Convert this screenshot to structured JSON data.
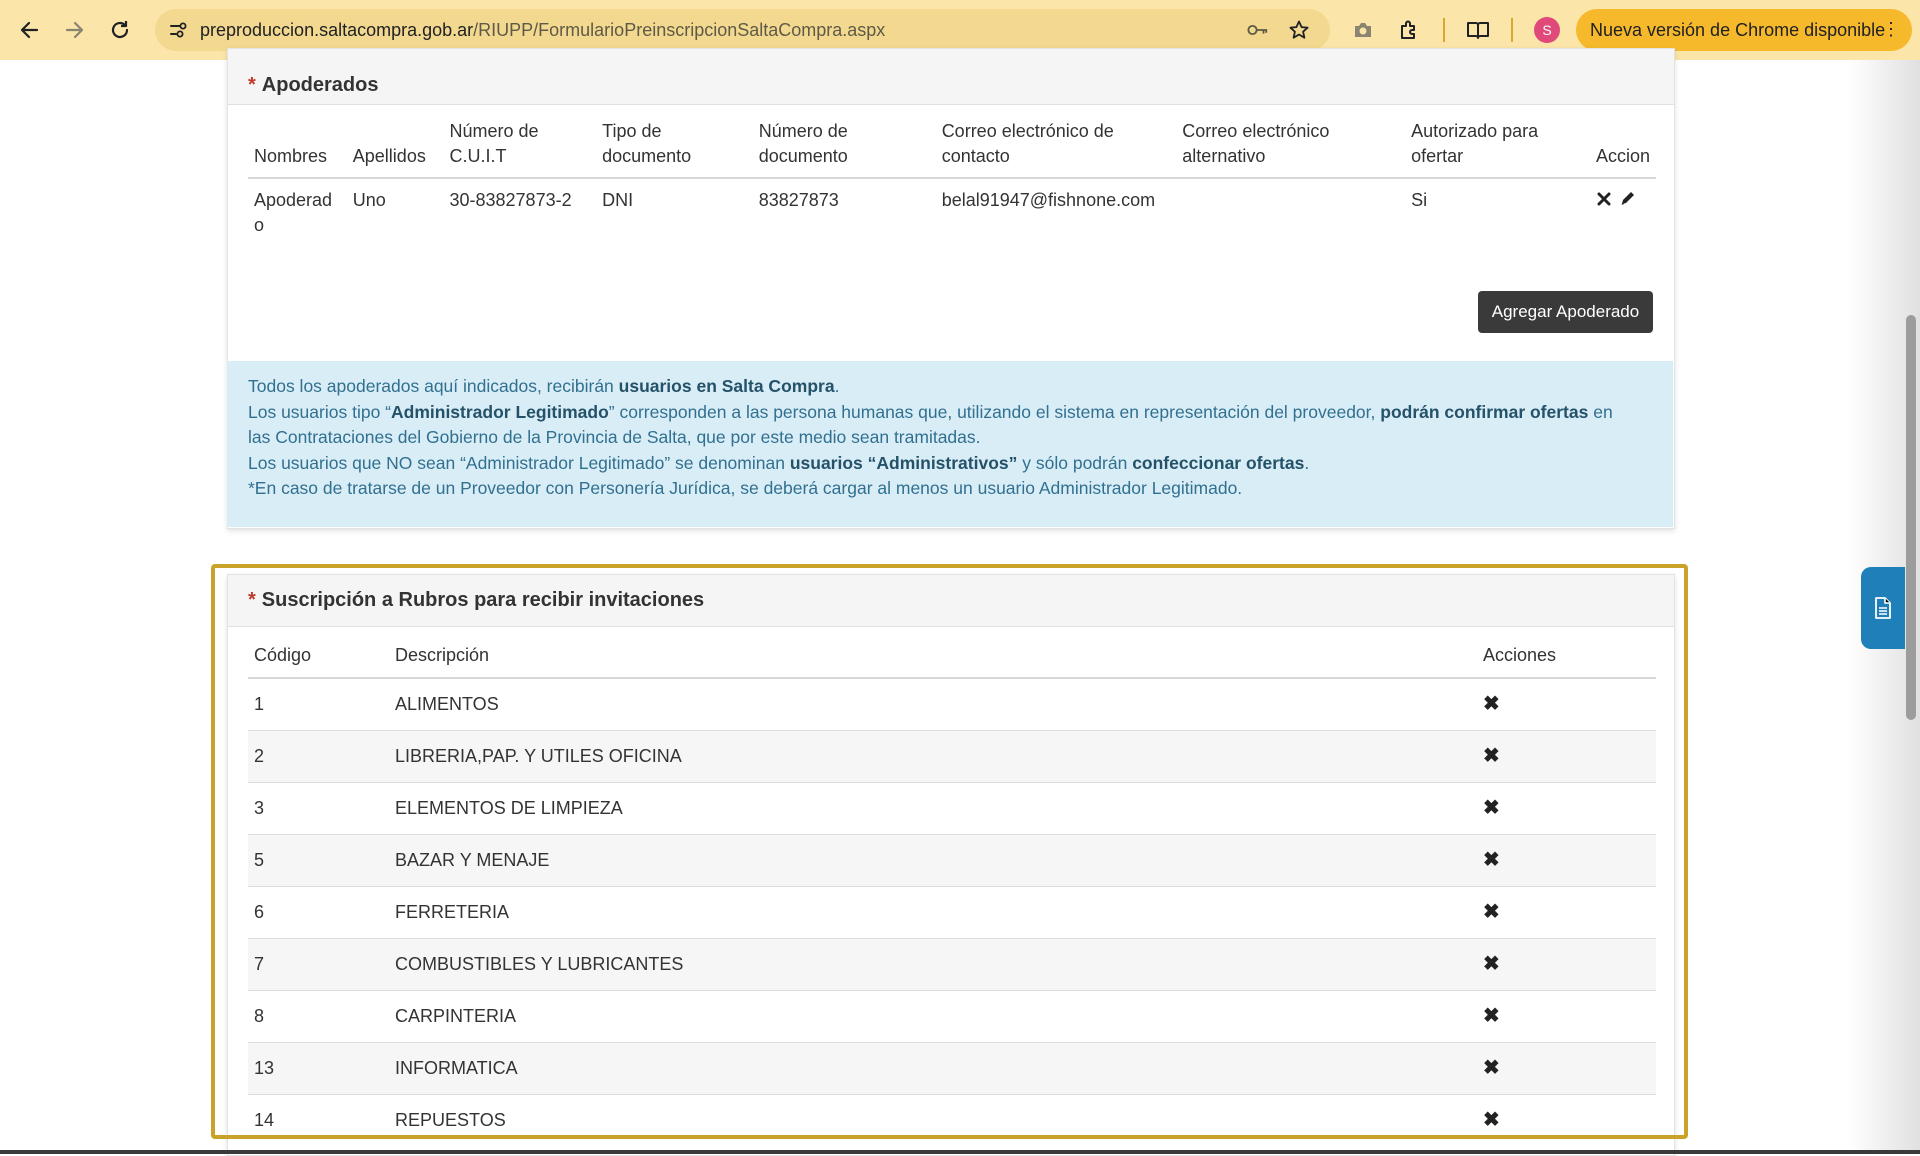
{
  "browser": {
    "url_host": "preproduccion.saltacompra.gob.ar",
    "url_path": "/RIUPP/FormularioPreinscripcionSaltaCompra.aspx",
    "avatar_letter": "S",
    "update_label": "Nueva versión de Chrome disponible",
    "menu_glyph": "⋮",
    "colors": {
      "toolbar": "#fbe5a8",
      "omnibox": "#f3d98f",
      "update_pill": "#f6b92b"
    },
    "icons": [
      "back-arrow-icon",
      "forward-arrow-icon",
      "reload-icon",
      "site-settings-icon",
      "password-key-icon",
      "bookmark-star-icon",
      "camera-icon",
      "extensions-icon",
      "reading-mode-icon"
    ]
  },
  "apoderados": {
    "required_mark": "*",
    "title": "Apoderados",
    "columns": {
      "nombres": "Nombres",
      "apellidos": "Apellidos",
      "cuit_1": "Número de",
      "cuit_2": "C.U.I.T",
      "tipo_doc_1": "Tipo de",
      "tipo_doc_2": "documento",
      "num_doc_1": "Número de",
      "num_doc_2": "documento",
      "correo_1": "Correo electrónico de",
      "correo_2": "contacto",
      "correo_alt_1": "Correo electrónico",
      "correo_alt_2": "alternativo",
      "autorizado_1": "Autorizado para",
      "autorizado_2": "ofertar",
      "accion": "Accion"
    },
    "rows": [
      {
        "nombres_1": "Apoderad",
        "nombres_2": "o",
        "apellidos": "Uno",
        "cuit": "30-83827873-2",
        "tipo_doc": "DNI",
        "num_doc": "83827873",
        "correo": "belal91947@fishnone.com",
        "correo_alt": "",
        "autorizado": "Si"
      }
    ],
    "add_button": "Agregar Apoderado"
  },
  "info": {
    "l1_a": "Todos los apoderados aquí indicados, recibirán ",
    "l1_b": "usuarios en Salta Compra",
    "l1_c": ".",
    "l2_a": "Los usuarios tipo “",
    "l2_b": "Administrador Legitimado",
    "l2_c": "” corresponden a las persona humanas que, utilizando el sistema en representación del proveedor, ",
    "l2_d": "podrán confirmar ofertas",
    "l2_e": " en",
    "l3": "las Contrataciones del Gobierno de la Provincia de Salta, que por este medio sean tramitadas.",
    "l4_a": "Los usuarios que NO sean “Administrador Legitimado” se denominan ",
    "l4_b": "usuarios “Administrativos”",
    "l4_c": " y sólo podrán ",
    "l4_d": "confeccionar ofertas",
    "l4_e": ".",
    "l5": "*En caso de tratarse de un Proveedor con Personería Jurídica, se deberá cargar al menos un usuario Administrador Legitimado."
  },
  "rubros": {
    "required_mark": "*",
    "title": "Suscripción a Rubros para recibir invitaciones",
    "columns": {
      "codigo": "Código",
      "descripcion": "Descripción",
      "acciones": "Acciones"
    },
    "delete_glyph": "✖",
    "rows": [
      {
        "codigo": "1",
        "descripcion": "ALIMENTOS"
      },
      {
        "codigo": "2",
        "descripcion": "LIBRERIA,PAP. Y UTILES OFICINA"
      },
      {
        "codigo": "3",
        "descripcion": "ELEMENTOS DE LIMPIEZA"
      },
      {
        "codigo": "5",
        "descripcion": "BAZAR Y MENAJE"
      },
      {
        "codigo": "6",
        "descripcion": "FERRETERIA"
      },
      {
        "codigo": "7",
        "descripcion": "COMBUSTIBLES Y LUBRICANTES"
      },
      {
        "codigo": "8",
        "descripcion": "CARPINTERIA"
      },
      {
        "codigo": "13",
        "descripcion": "INFORMATICA"
      },
      {
        "codigo": "14",
        "descripcion": "REPUESTOS"
      }
    ],
    "highlight_color": "#c9a227"
  },
  "side_tab": {
    "icon": "document-icon",
    "color": "#1f7fb8"
  }
}
